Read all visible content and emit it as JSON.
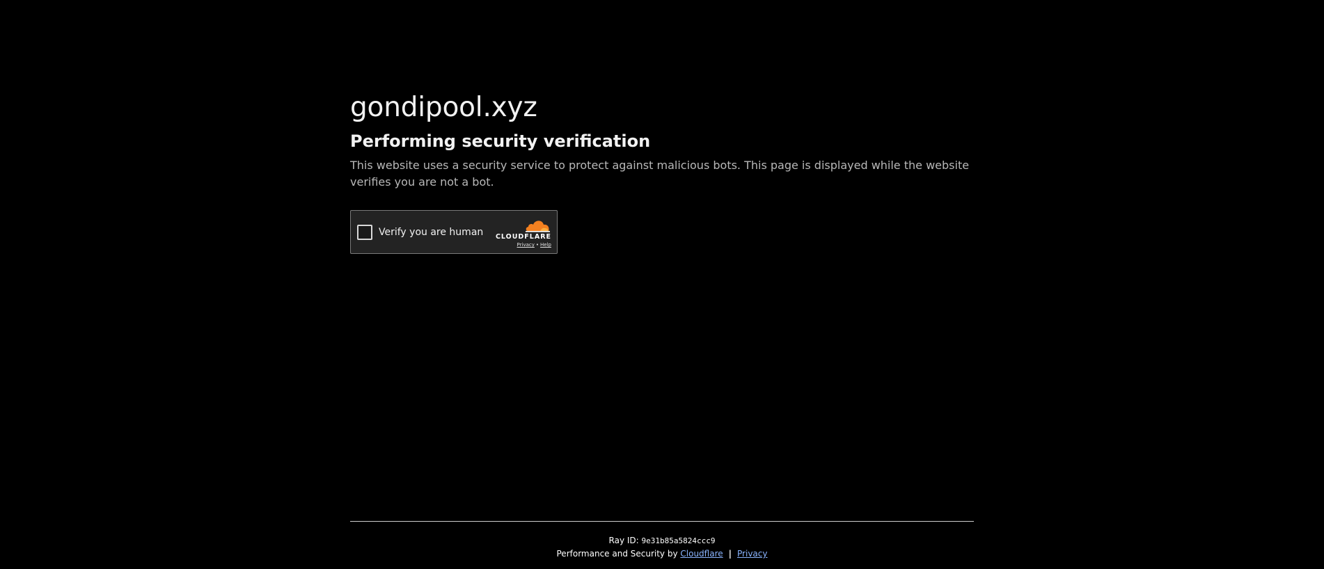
{
  "site": {
    "domain": "gondipool.xyz"
  },
  "challenge": {
    "heading": "Performing security verification",
    "description": "This website uses a security service to protect against malicious bots. This page is displayed while the website verifies you are not a bot."
  },
  "widget": {
    "checkbox_label": "Verify you are human",
    "brand_name": "CLOUDFLARE",
    "privacy_link": "Privacy",
    "separator": "•",
    "help_link": "Help",
    "brand_icon": "cloudflare-cloud-icon",
    "brand_color": "#f38020"
  },
  "footer": {
    "ray_label": "Ray ID:",
    "ray_id": "9e31b85a5824ccc9",
    "performance_text": "Performance and Security by",
    "cloudflare_link": "Cloudflare",
    "divider": "|",
    "privacy_link": "Privacy"
  }
}
